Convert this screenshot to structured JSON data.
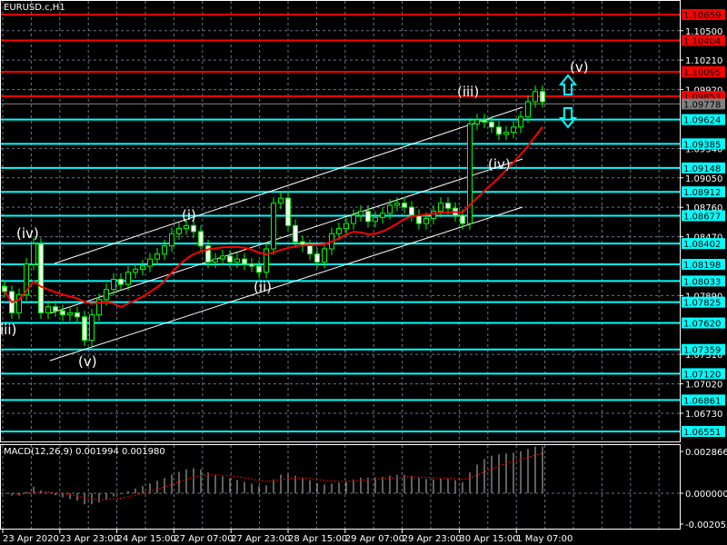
{
  "window": {
    "title": "EURUSD.c,H1"
  },
  "colors": {
    "background": "#000000",
    "bull_candle": "#00ff00",
    "bear_candle": "#ffffff",
    "ma": "#ff0000",
    "resistance": "#ff0000",
    "support": "#00ffff",
    "current_price": "#808080",
    "channel": "#ffffff"
  },
  "price_axis": {
    "ticks": [
      "1.10500",
      "1.10210",
      "1.09920",
      "1.09340",
      "1.09050",
      "1.08760",
      "1.08470",
      "1.07890",
      "1.07310",
      "1.07020",
      "1.06730"
    ],
    "levels": [
      {
        "price": "1.10659",
        "kind": "resistance"
      },
      {
        "price": "1.10404",
        "kind": "resistance"
      },
      {
        "price": "1.10095",
        "kind": "resistance"
      },
      {
        "price": "1.09853",
        "kind": "resistance"
      },
      {
        "price": "1.09778",
        "kind": "current"
      },
      {
        "price": "1.09624",
        "kind": "support"
      },
      {
        "price": "1.09385",
        "kind": "support"
      },
      {
        "price": "1.09148",
        "kind": "support"
      },
      {
        "price": "1.08912",
        "kind": "support"
      },
      {
        "price": "1.08677",
        "kind": "support"
      },
      {
        "price": "1.08402",
        "kind": "support"
      },
      {
        "price": "1.08198",
        "kind": "support"
      },
      {
        "price": "1.08033",
        "kind": "support"
      },
      {
        "price": "1.07825",
        "kind": "support"
      },
      {
        "price": "1.07620",
        "kind": "support"
      },
      {
        "price": "1.07359",
        "kind": "support"
      },
      {
        "price": "1.07120",
        "kind": "support"
      },
      {
        "price": "1.06861",
        "kind": "support"
      },
      {
        "price": "1.06551",
        "kind": "support"
      }
    ]
  },
  "time_axis": {
    "labels": [
      "23 Apr 2020",
      "23 Apr 23:00",
      "24 Apr 15:00",
      "27 Apr 07:00",
      "27 Apr 23:00",
      "28 Apr 15:00",
      "29 Apr 07:00",
      "29 Apr 23:00",
      "30 Apr 15:00",
      "1 May 07:00"
    ]
  },
  "wave_labels": [
    "(iv)",
    "iii)",
    "(v)",
    "(i)",
    "(ii)",
    "(iii)",
    "(iv)",
    "(v)"
  ],
  "arrows": [
    "arrow-up-icon",
    "arrow-down-icon"
  ],
  "macd": {
    "label": "MACD(12,26,9) 0.001994 0.001980",
    "ticks": [
      "0.002866",
      "0.000000",
      "-0.002055"
    ]
  },
  "chart_data": {
    "type": "candlestick",
    "symbol": "EURUSD.c",
    "timeframe": "H1",
    "ylim": [
      1.0642,
      1.108
    ],
    "closes": [
      1.0793,
      1.0772,
      1.079,
      1.082,
      1.084,
      1.0772,
      1.0778,
      1.0774,
      1.077,
      1.0772,
      1.0768,
      1.0745,
      1.077,
      1.0785,
      1.0795,
      1.0805,
      1.08,
      1.0812,
      1.0815,
      1.0818,
      1.0825,
      1.083,
      1.0838,
      1.085,
      1.0855,
      1.0858,
      1.0852,
      1.0838,
      1.0822,
      1.0825,
      1.0828,
      1.0822,
      1.0825,
      1.082,
      1.0818,
      1.0812,
      1.0835,
      1.088,
      1.0885,
      1.0858,
      1.0842,
      1.0838,
      1.083,
      1.0822,
      1.0835,
      1.085,
      1.0855,
      1.086,
      1.0868,
      1.0872,
      1.0862,
      1.0866,
      1.087,
      1.0878,
      1.088,
      1.0876,
      1.0868,
      1.086,
      1.0865,
      1.0872,
      1.088,
      1.0875,
      1.0868,
      1.086,
      1.0958,
      1.0962,
      1.096,
      1.0955,
      1.0948,
      1.095,
      1.0955,
      1.0965,
      1.098,
      1.099,
      1.098
    ]
  }
}
